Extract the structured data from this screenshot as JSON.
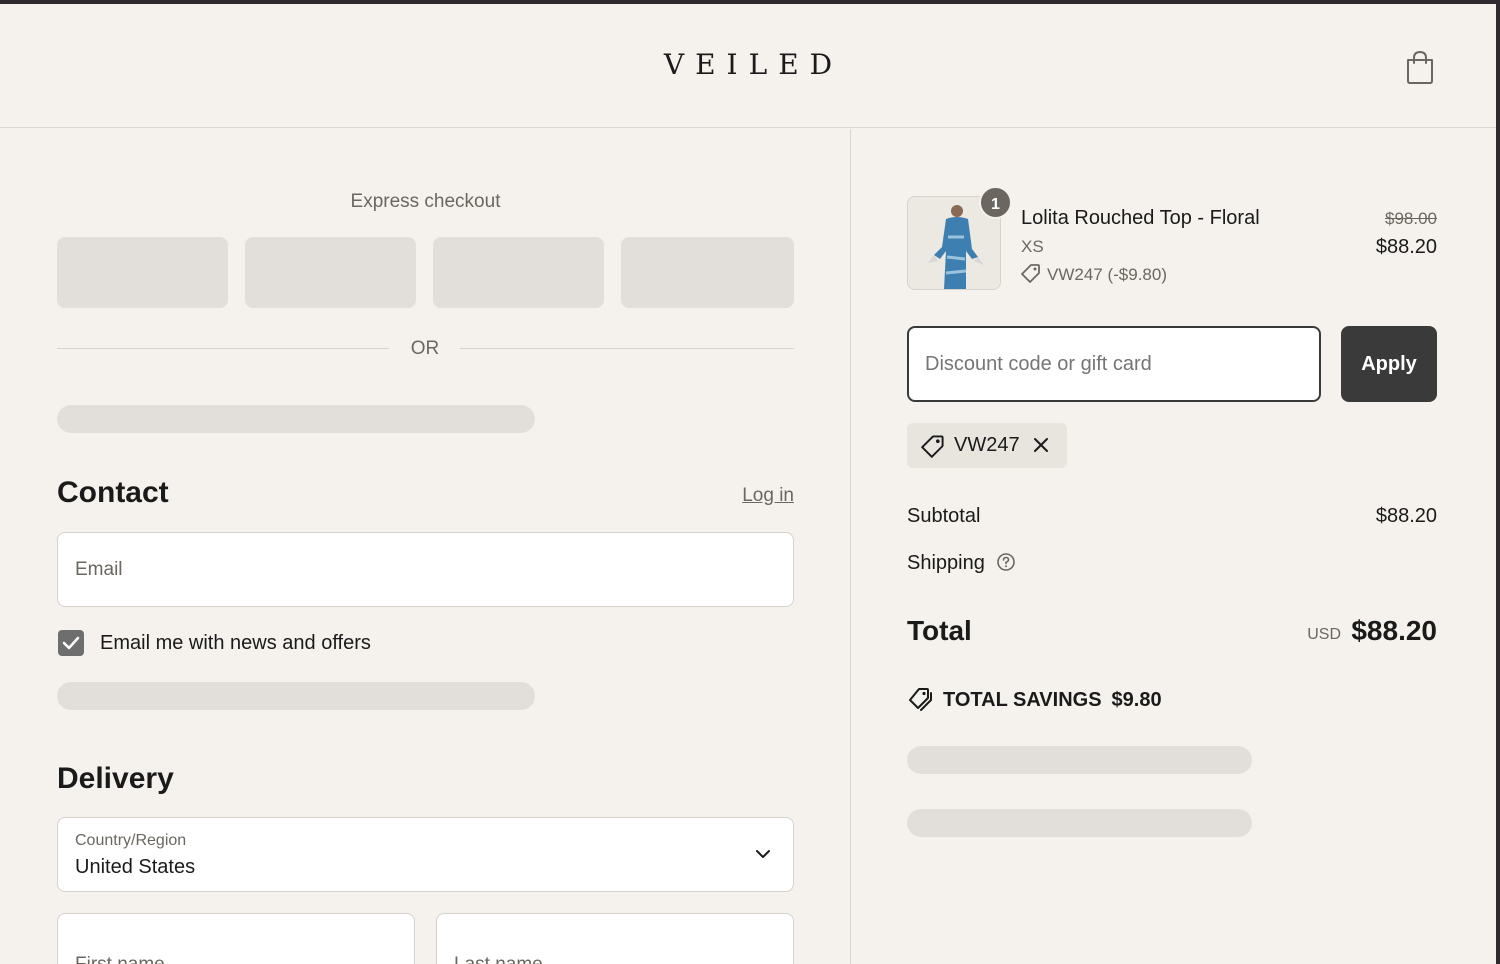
{
  "brand": {
    "logo": "VEILED"
  },
  "express": {
    "title": "Express checkout",
    "or_label": "OR"
  },
  "contact": {
    "heading": "Contact",
    "login_label": "Log in",
    "email_placeholder": "Email",
    "newsletter_label": "Email me with news and offers",
    "newsletter_checked": true
  },
  "delivery": {
    "heading": "Delivery",
    "country_label": "Country/Region",
    "country_value": "United States",
    "first_name_placeholder": "First name",
    "last_name_placeholder": "Last name"
  },
  "order": {
    "item": {
      "quantity": "1",
      "name": "Lolita Rouched Top - Floral",
      "variant": "XS",
      "discount_line": "VW247 (-$9.80)",
      "original_price": "$98.00",
      "price": "$88.20"
    },
    "discount_placeholder": "Discount code or gift card",
    "apply_label": "Apply",
    "applied_code": "VW247",
    "subtotal_label": "Subtotal",
    "subtotal_value": "$88.20",
    "shipping_label": "Shipping",
    "total_label": "Total",
    "currency": "USD",
    "total_value": "$88.20",
    "savings_label": "TOTAL SAVINGS",
    "savings_value": "$9.80"
  },
  "colors": {
    "background": "#f5f2ed",
    "skeleton": "#e2dfda",
    "button_dark": "#3a3a3a",
    "muted_text": "#6b6760"
  }
}
